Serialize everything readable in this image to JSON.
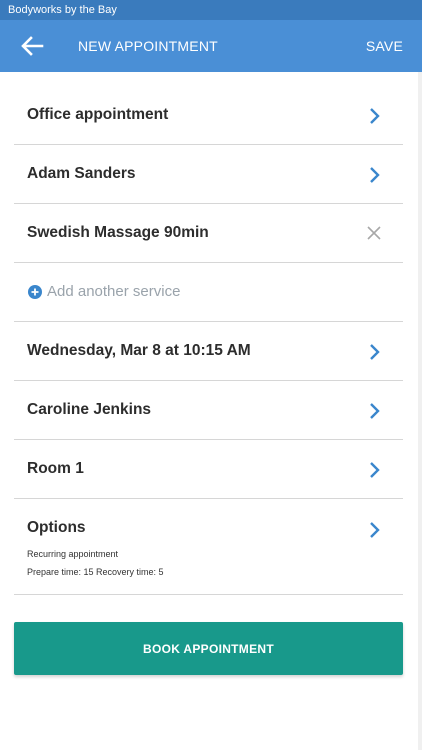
{
  "status_bar": {
    "app_name": "Bodyworks by the Bay"
  },
  "app_bar": {
    "title": "NEW APPOINTMENT",
    "save_label": "SAVE",
    "back_icon": "arrow-left-icon"
  },
  "rows": {
    "location": "Office appointment",
    "client": "Adam Sanders",
    "service": "Swedish Massage 90min",
    "add_service": "Add another service",
    "datetime": "Wednesday, Mar 8 at 10:15 AM",
    "staff": "Caroline Jenkins",
    "room": "Room 1",
    "options": {
      "label": "Options",
      "line1": "Recurring appointment",
      "line2": "Prepare time: 15 Recovery time: 5"
    }
  },
  "book_button": {
    "label": "BOOK APPOINTMENT"
  },
  "colors": {
    "app_bar": "#4a8fd6",
    "status_bar": "#3a7bbd",
    "accent": "#18998b",
    "chevron": "#3a86cc"
  }
}
